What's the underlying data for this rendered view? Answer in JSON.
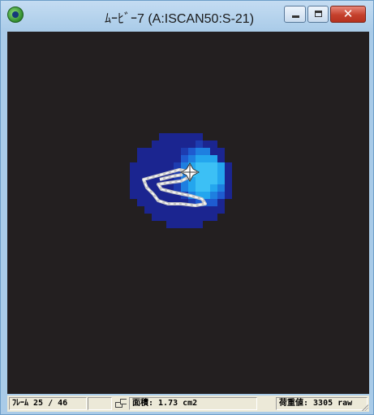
{
  "window": {
    "title": "ﾑｰﾋﾞｰ7 (A:ISCAN50:S-21)",
    "app_icon": "app-icon",
    "caption_buttons": [
      "minimize-icon",
      "maximize-icon",
      "close-icon"
    ]
  },
  "image": {
    "background_color": "#231f20",
    "roi_outline_color": "#c8c8c8",
    "cursor_icon": "crosshair-icon",
    "heatmap_colors": [
      "#1b2590",
      "#1d3cb0",
      "#1e5bd0",
      "#1e7fe0",
      "#24a6ee",
      "#3cc0f5"
    ]
  },
  "status": {
    "frame_label": "ﾌﾚｰﾑ 25 / 46",
    "blank": "",
    "layers_icon": "layers-icon",
    "area_label": "面積: 1.73 cm2",
    "intensity_label": "荷重値: 3305 raw"
  }
}
